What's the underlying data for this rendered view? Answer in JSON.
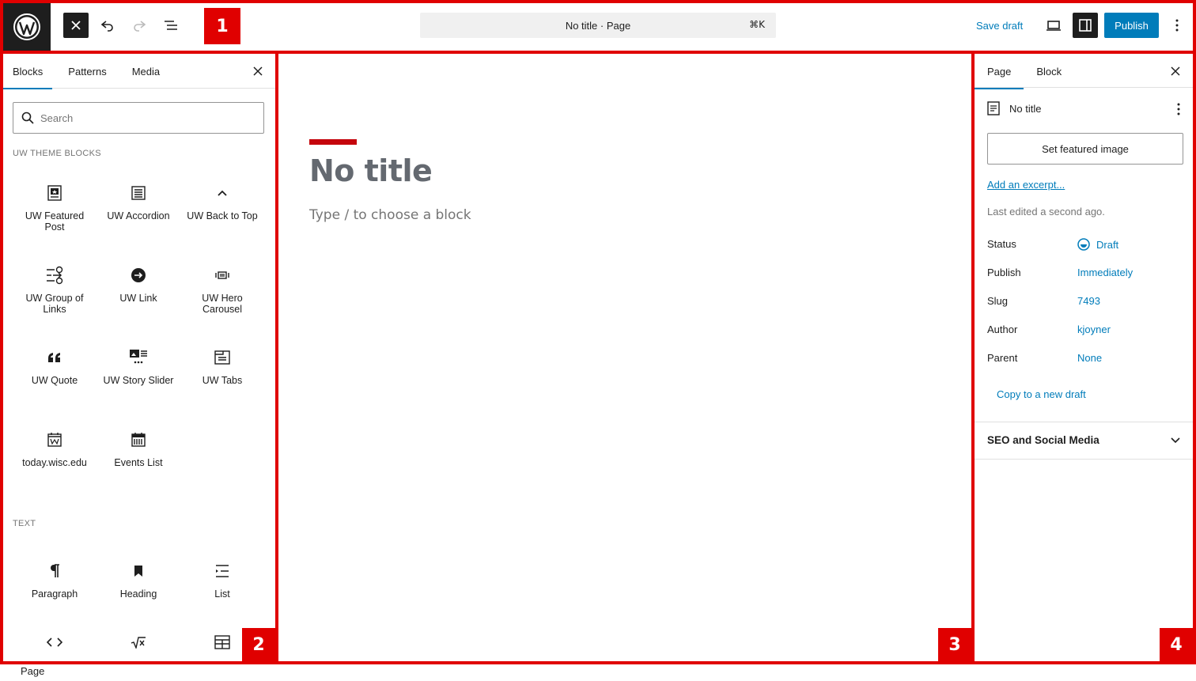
{
  "topbar": {
    "undo_icon": "undo-icon",
    "redo_icon": "redo-icon",
    "list_view_icon": "list-view-icon",
    "document_bar": {
      "title": "No title · Page",
      "shortcut": "⌘K"
    },
    "save_draft_label": "Save draft",
    "publish_label": "Publish",
    "preview_icon": "laptop-icon",
    "settings_icon": "sidebar-toggle-icon",
    "options_icon": "kebab-icon"
  },
  "callouts": {
    "one": "1",
    "two": "2",
    "three": "3",
    "four": "4"
  },
  "inserter": {
    "tabs": [
      "Blocks",
      "Patterns",
      "Media"
    ],
    "search_placeholder": "Search",
    "sections": [
      {
        "title": "UW THEME BLOCKS",
        "blocks": [
          {
            "label": "UW Featured Post",
            "icon": "featured-post-icon"
          },
          {
            "label": "UW Accordion",
            "icon": "accordion-icon"
          },
          {
            "label": "UW Back to Top",
            "icon": "chevron-up-icon"
          },
          {
            "label": "UW Group of Links",
            "icon": "group-links-icon"
          },
          {
            "label": "UW Link",
            "icon": "arrow-circle-icon"
          },
          {
            "label": "UW Hero Carousel",
            "icon": "carousel-icon"
          },
          {
            "label": "UW Quote",
            "icon": "quote-icon"
          },
          {
            "label": "UW Story Slider",
            "icon": "story-slider-icon"
          },
          {
            "label": "UW Tabs",
            "icon": "tabs-icon"
          },
          {
            "label": "today.wisc.edu",
            "icon": "calendar-w-icon"
          },
          {
            "label": "Events List",
            "icon": "events-calendar-icon"
          }
        ]
      },
      {
        "title": "TEXT",
        "blocks": [
          {
            "label": "Paragraph",
            "icon": "paragraph-icon"
          },
          {
            "label": "Heading",
            "icon": "bookmark-icon"
          },
          {
            "label": "List",
            "icon": "list-icon"
          },
          {
            "label": "",
            "icon": "code-icon"
          },
          {
            "label": "",
            "icon": "math-icon"
          },
          {
            "label": "",
            "icon": "table-icon"
          }
        ]
      }
    ]
  },
  "editor": {
    "title": "No title",
    "block_prompt": "Type / to choose a block"
  },
  "sidebar": {
    "tabs": [
      "Page",
      "Block"
    ],
    "doc_title": "No title",
    "featured_image_label": "Set featured image",
    "excerpt_link": "Add an excerpt...",
    "last_edited": "Last edited a second ago.",
    "meta": [
      {
        "key": "Status",
        "value": "Draft"
      },
      {
        "key": "Publish",
        "value": "Immediately"
      },
      {
        "key": "Slug",
        "value": "7493"
      },
      {
        "key": "Author",
        "value": "kjoyner"
      },
      {
        "key": "Parent",
        "value": "None"
      }
    ],
    "copy_draft": "Copy to a new draft",
    "seo_panel": "SEO and Social Media"
  },
  "footer": {
    "breadcrumb": "Page"
  },
  "colors": {
    "accent": "#007cba",
    "callout": "#e00000",
    "title_bar": "#c5050c",
    "dark": "#1e1e1e"
  }
}
